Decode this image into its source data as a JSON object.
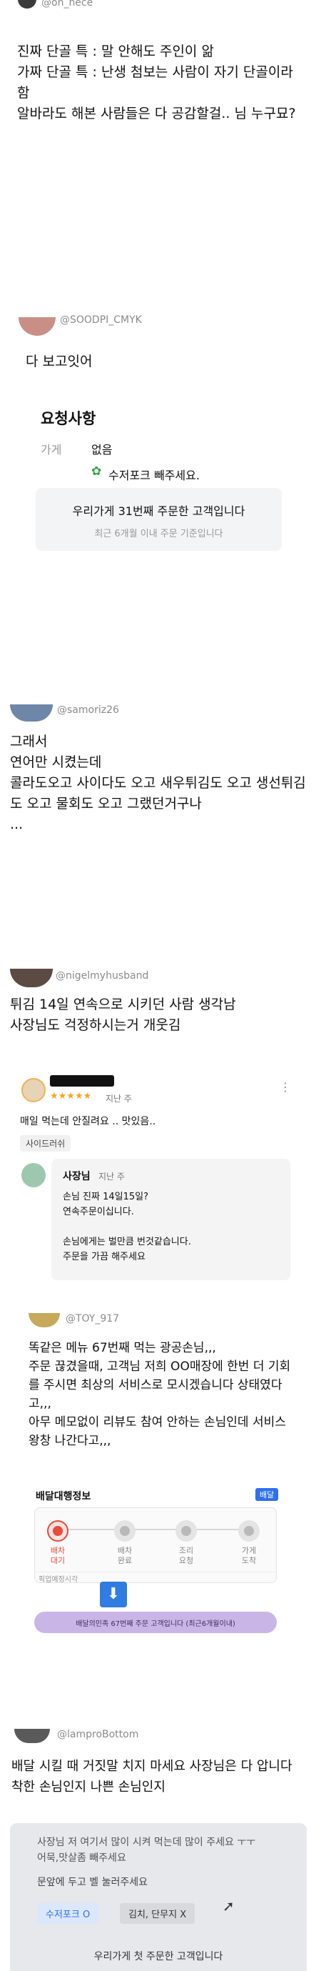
{
  "section1": {
    "handle": "@oh_nece",
    "text": "진짜 단골 특 : 말 안해도 주인이 앎\n가짜 단골 특 : 난생 첨보는 사람이 자기 단골이라함\n알바라도 해본 사람들은 다 공감할걸.. 님 누구묘?"
  },
  "section2": {
    "handle": "@SOODPI_CMYK",
    "text": "다 보고잇어",
    "request_title": "요청사항",
    "store_label": "가게",
    "store_value": "없음",
    "spoon_text": "수저포크 빼주세요.",
    "order_count": "우리가게 31번째 주문한 고객입니다",
    "order_sub": "최근 6개월 이내 주문 기준입니다"
  },
  "section3": {
    "handle": "@samoriz26",
    "text": "그래서\n연어만 시켰는데\n콜라도오고 사이다도 오고 새우튀김도 오고 생선튀김도 오고 물회도 오고 그랬던거구나\n..."
  },
  "section4": {
    "handle": "@nigelmyhusband",
    "text": "튀김 14일 연속으로 시키던 사람 생각남\n사장님도 걱정하시는거 개웃김",
    "stars": "★★★★★",
    "rating": 5,
    "review_time": "지난 주",
    "review_text": "매일 먹는데 안질려요 .. 맛있음..",
    "side_tag": "사이드러쉬",
    "owner_label": "사장님",
    "owner_time": "지난 주",
    "owner_reply": "손님 진짜 14일15일?\n연속주문이십니다.\n\n손님에게는 벌만큼 번것같습니다.\n주문을 가끔 해주세요"
  },
  "section5": {
    "handle": "@TOY_917",
    "text": "똑같은 메뉴 67번째 먹는 광공손님,,,\n주문 끊겼을때, 고객님 저희 OO매장에 한번 더 기회를 주시면 최상의 서비스로 모시겠습니다 상태였다고,,,\n아무 메모없이 리뷰도 참여 안하는 손님인데 서비스 왕창 나간다고,,,",
    "delivery_title": "배달대행정보",
    "delivery_badge": "배달",
    "steps": [
      "배차\n대기",
      "배차\n완료",
      "조리\n요청",
      "가게\n도착"
    ],
    "time_label": "픽업예정시각",
    "order_count": "배달의민족 67번째 주문 고객입니다 (최근6개월이내)"
  },
  "section6": {
    "handle": "@lamproBottom",
    "text": "배달 시킬 때 거짓말 치지 마세요 사장님은 다 압니다 착한 손님인지 나쁜 손님인지",
    "memo_text": "사장님 저 여기서 많이 시켜 먹는데 많이 주세요 ㅜㅜ\n어묵,맛살좀 빼주세요",
    "door_text": "문앞에 두고 벨 눌러주세요",
    "spoon_btn": "수저포크 O",
    "kimchi_btn": "김치, 단무지 X",
    "order_count": "우리가게 첫 주문한 고객입니다"
  },
  "colors": {
    "accent_blue": "#2f6fed",
    "purple_bar": "#c9b6e6",
    "red_step": "#e64b3b"
  }
}
